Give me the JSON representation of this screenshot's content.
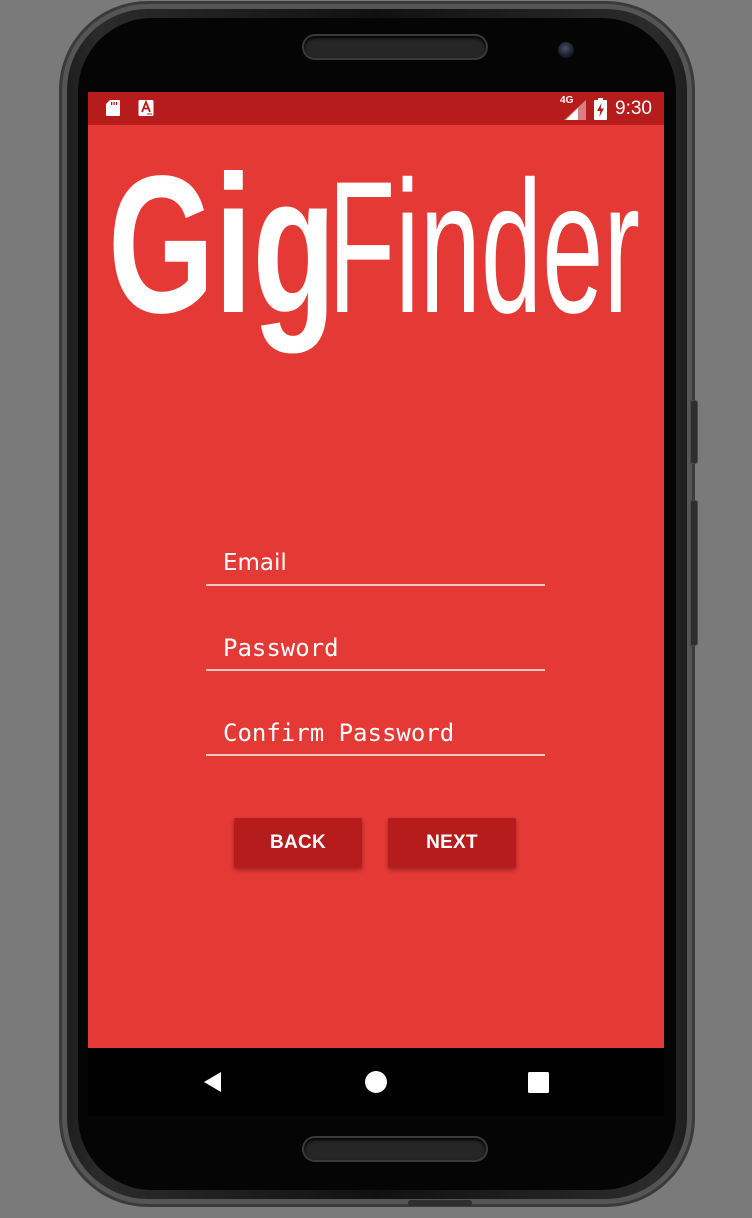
{
  "status_bar": {
    "time": "9:30",
    "network": "4G",
    "icons": [
      "sd-card-icon",
      "accessibility-app-icon",
      "signal-icon",
      "battery-charging-icon"
    ]
  },
  "logo": {
    "part1": "Gig",
    "part2": "Finder"
  },
  "form": {
    "email_placeholder": "Email",
    "email_value": "",
    "password_placeholder": "Password",
    "password_value": "",
    "confirm_placeholder": "Confirm Password",
    "confirm_value": ""
  },
  "buttons": {
    "back_label": "BACK",
    "next_label": "NEXT"
  },
  "nav": {
    "icons": [
      "back-triangle-icon",
      "home-circle-icon",
      "recents-square-icon"
    ]
  },
  "colors": {
    "primary": "#e53935",
    "primary_dark": "#b71c1c",
    "text": "#ffffff",
    "device_background": "#7a7a7a"
  }
}
